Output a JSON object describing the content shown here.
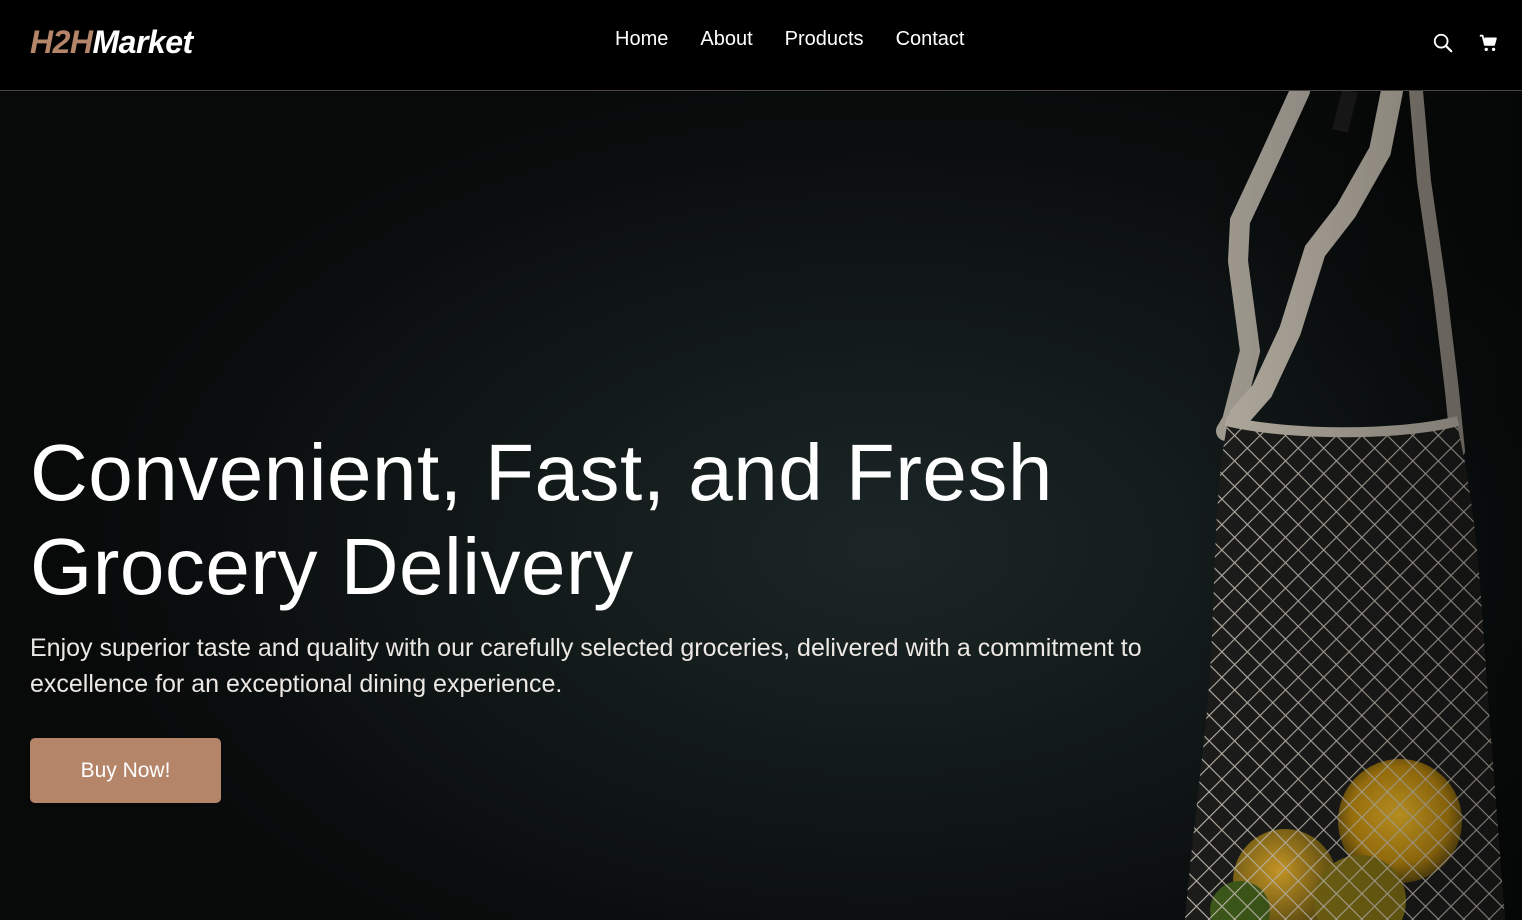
{
  "brand": {
    "logo_accent": "H2H",
    "logo_rest": "Market",
    "accent_color": "#b5856a"
  },
  "nav": {
    "items": [
      {
        "label": "Home"
      },
      {
        "label": "About"
      },
      {
        "label": "Products"
      },
      {
        "label": "Contact"
      }
    ]
  },
  "header_icons": [
    "search-icon",
    "cart-icon"
  ],
  "hero": {
    "headline": "Convenient, Fast, and Fresh Grocery Delivery",
    "subtext": "Enjoy superior taste and quality with our carefully selected groceries, delivered with a commitment to excellence for an exceptional dining experience.",
    "cta_label": "Buy Now!",
    "background_image": "mesh-grocery-bag"
  }
}
